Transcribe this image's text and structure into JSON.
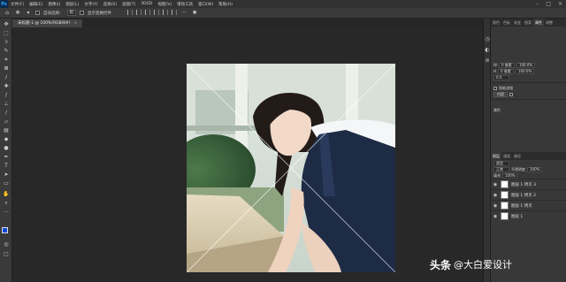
{
  "menubar": {
    "logo": "Ps",
    "items": [
      "文件(F)",
      "编辑(E)",
      "图像(I)",
      "图层(L)",
      "文字(Y)",
      "选择(S)",
      "滤镜(T)",
      "3D(D)",
      "视图(V)",
      "增效工具",
      "窗口(W)",
      "帮助(H)"
    ]
  },
  "options": {
    "auto_select_label": "自动选择：",
    "auto_select_value": "组",
    "show_transform_label": "显示变换控件"
  },
  "document": {
    "tab_title": "未标题-1 @ 100%(RGB/8#)"
  },
  "panels": {
    "top_tabs": [
      "颜色",
      "色板",
      "渐变",
      "图案",
      "属性",
      "调整"
    ],
    "active_tab": "属性",
    "transform": {
      "w_label": "W",
      "w_value": "100.0%",
      "h_label": "H",
      "h_value": "100.0%",
      "x_value": "0 像素",
      "y_value": "0 像素",
      "angle_value": "0.0"
    },
    "smart_label": "智能滤镜",
    "content_label": "内容",
    "props_label": "属性",
    "layers_tabs": [
      "图层",
      "通道",
      "路径"
    ],
    "kind_label": "类型",
    "mode": "正常",
    "opacity_label": "不透明度",
    "opacity": "100%",
    "fill_label": "填充",
    "fill": "100%",
    "layers": [
      "图层 1 拷贝 3",
      "图层 1 拷贝 2",
      "图层 1 拷贝",
      "图层 1"
    ]
  },
  "watermark": {
    "site": "头条",
    "author": "@大白爱设计"
  },
  "colors": {
    "foreground": "#0a4bd6",
    "background": "#ffffff"
  }
}
